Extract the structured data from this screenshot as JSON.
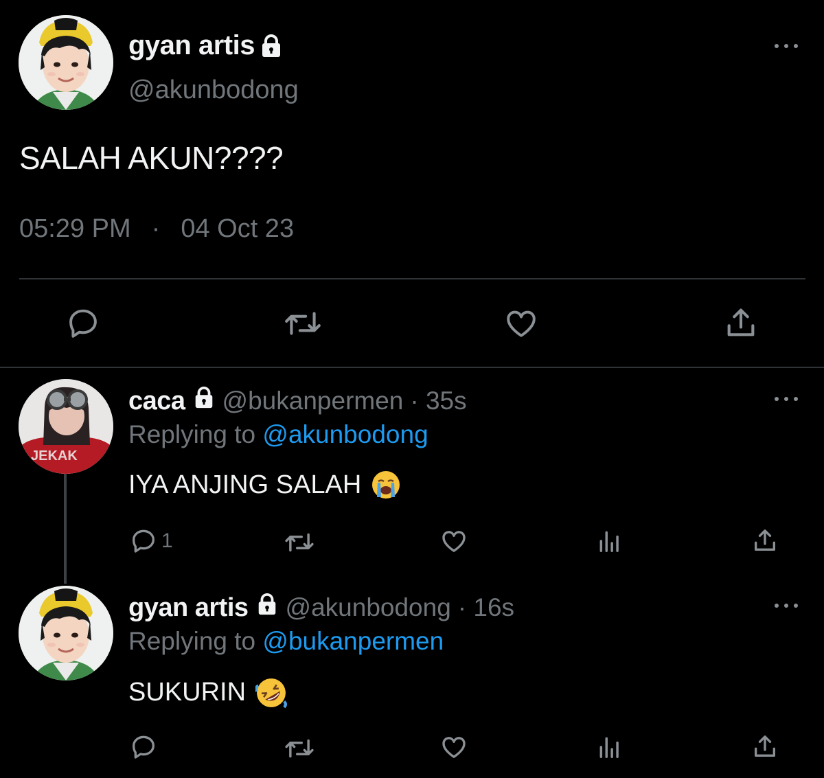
{
  "main_tweet": {
    "name": "gyan artis",
    "handle": "@akunbodong",
    "text": "SALAH AKUN????",
    "time": "05:29 PM",
    "separator": "·",
    "date": "04 Oct 23"
  },
  "replies": [
    {
      "name": "caca",
      "handle": "@bukanpermen",
      "age": "· 35s",
      "replying_prefix": "Replying to",
      "replying_to": "@akunbodong",
      "text": "IYA ANJING SALAH",
      "emoji": "loudly-crying-face",
      "reply_count": "1"
    },
    {
      "name": "gyan artis",
      "handle": "@akunbodong",
      "age": "· 16s",
      "replying_prefix": "Replying to",
      "replying_to": "@bukanpermen",
      "text": "SUKURIN",
      "emoji": "rolling-on-floor-laughing-face",
      "reply_count": ""
    }
  ],
  "colors": {
    "background": "#000000",
    "text": "#f1f3f4",
    "muted": "#71767b",
    "link": "#1d9bf0",
    "divider": "#2f3336"
  },
  "icons": [
    "reply-icon",
    "retweet-icon",
    "like-icon",
    "share-icon",
    "views-icon",
    "more-icon",
    "lock-icon"
  ]
}
